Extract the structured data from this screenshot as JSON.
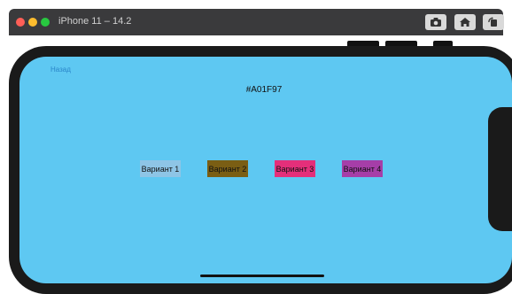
{
  "window": {
    "title": "iPhone 11 – 14.2"
  },
  "screen": {
    "back_label": "Назад",
    "color_hex": "#A01F97",
    "background_color": "#5EC8F2",
    "variants": [
      {
        "label": "Вариант 1",
        "color": "#8EC5E6"
      },
      {
        "label": "Вариант 2",
        "color": "#7A5E14"
      },
      {
        "label": "Вариант 3",
        "color": "#E42F7A"
      },
      {
        "label": "Вариант 4",
        "color": "#A63EA8"
      }
    ]
  }
}
